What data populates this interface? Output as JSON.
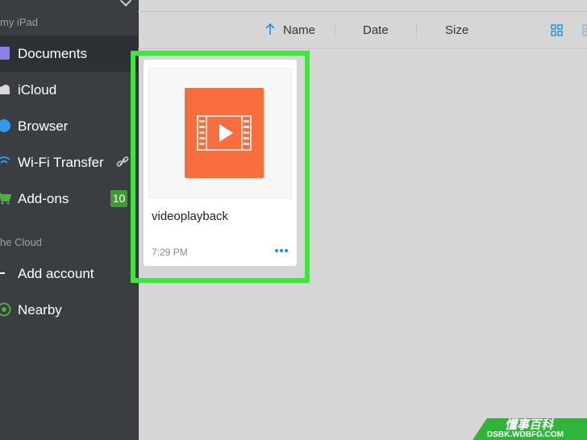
{
  "sidebar": {
    "sections": {
      "local": "my iPad",
      "cloud": "he Cloud"
    },
    "items": [
      {
        "label": "Documents",
        "icon": "documents-icon",
        "active": true
      },
      {
        "label": "iCloud",
        "icon": "icloud-icon"
      },
      {
        "label": "Browser",
        "icon": "browser-icon"
      },
      {
        "label": "Wi-Fi Transfer",
        "icon": "wifi-icon"
      },
      {
        "label": "Add-ons",
        "icon": "cart-icon",
        "badge": "10"
      },
      {
        "label": "Add account",
        "icon": "plus-icon"
      },
      {
        "label": "Nearby",
        "icon": "nearby-icon"
      }
    ]
  },
  "toolbar": {
    "sort_name": "Name",
    "sort_date": "Date",
    "sort_size": "Size"
  },
  "files": [
    {
      "name": "videoplayback",
      "time": "7:29 PM",
      "icon": "video-file-icon"
    }
  ],
  "watermark": {
    "title": "懂事百科",
    "url": "DSBK.WDBFG.COM"
  },
  "colors": {
    "sidebar": "#3a3e43",
    "accent": "#1f8fe0",
    "highlight": "#3bea38",
    "video_icon": "#f86e3e",
    "badge": "#3f9c35"
  }
}
